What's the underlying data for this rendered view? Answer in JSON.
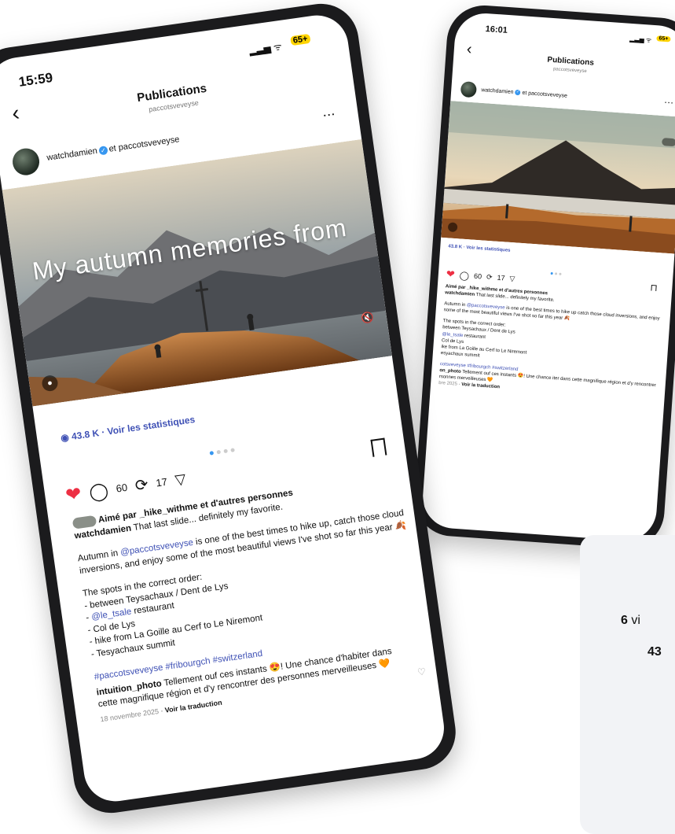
{
  "left_phone": {
    "time": "15:59",
    "battery": "65+",
    "header_title": "Publications",
    "header_sub": "paccotsveveyse",
    "author_name": "watchdamien",
    "author_rest": "et paccotsveveyse",
    "media_caption": "My autumn memories from",
    "views": "43.8 K · Voir les statistiques",
    "comments": "60",
    "reposts": "17",
    "liked_by": "Aimé par _hike_withme et d'autres personnes",
    "caption_user": "watchdamien",
    "caption_text": "That last slide... definitely my favorite.",
    "body_p1_a": "Autumn in ",
    "body_p1_link": "@paccotsveveyse",
    "body_p1_b": " is one of the best times to hike up, catch those cloud inversions, and enjoy some of the most beautiful views I've shot so far this year 🍂",
    "spots_title": "The spots in the correct order:",
    "spot1": "- between Teysachaux / Dent de Lys",
    "spot2_dash": "- ",
    "spot2_link": "@le_tsale",
    "spot2_rest": " restaurant",
    "spot3": "- Col de Lys",
    "spot4": "- hike from La Goille au Cerf to Le Niremont",
    "spot5": "- Tesyachaux summit",
    "hashtags": "#paccotsveveyse #fribourgch #switzerland",
    "comment_user": "intuition_photo",
    "comment_text": "Tellement ouf ces instants 😍! Une chance d'habiter dans cette magnifique région et d'y rencontrer des personnes merveilleuses 🧡",
    "date": "18 novembre 2025",
    "translate": "Voir la traduction"
  },
  "right_phone": {
    "time": "16:01",
    "battery": "65+",
    "header_title": "Publications",
    "header_sub": "paccotsveveyse",
    "author_name": "watchdamien",
    "author_rest": "et paccotsveveyse",
    "views": "43.8 K · Voir les statistiques",
    "comments": "60",
    "reposts": "17",
    "liked_by": "Aimé par _hike_withme et d'autres personnes",
    "caption_user": "watchdamien",
    "caption_text": "That last slide... definitely my favorite.",
    "body_p1_a": "Autumn in ",
    "body_p1_link": "@paccotsveveyse",
    "body_p1_b": " is one of the best times to hike up catch those cloud inversions, and enjoy some of the most beautiful views I've shot so far this year 🍂",
    "spots_title": "The spots in the correct order:",
    "spot1": "between Teysachaux / Dent de Lys",
    "spot2_link": "@le_tsale",
    "spot2_rest": " restaurant",
    "spot3": "Col de Lys",
    "spot4": "ike from La Goille au Cerf to Le Niremont",
    "spot5": "esyachaux summit",
    "hashtags": "cotsveveyse #fribourgch #switzerland",
    "comment_user": "on_photo",
    "comment_text": "Tellement ouf ces instants 😍! Une chance iter dans cette magnifique région et d'y rencontrer rsonnes merveilleuses 🧡",
    "date": "bre 2025",
    "translate": "Voir la traduction"
  },
  "side_card": {
    "line1_value": "6",
    "line1_rest": "vi",
    "line2_value": "43"
  },
  "colors": {
    "accent": "#3797f0",
    "link": "#3f51b5",
    "like": "#ed2f43",
    "battery": "#ffd400"
  }
}
